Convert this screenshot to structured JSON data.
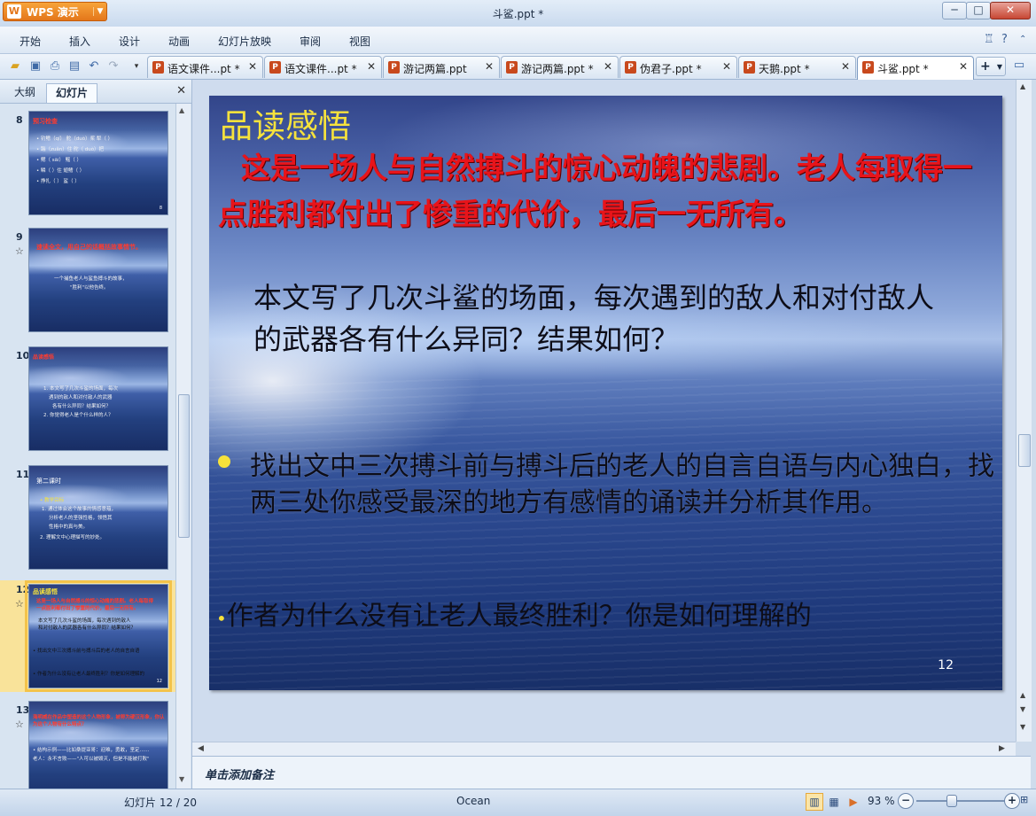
{
  "window": {
    "app_name": "WPS 演示",
    "title": "斗鲨.ppt *",
    "min": "─",
    "max": "□",
    "close": "✕"
  },
  "menu": [
    "开始",
    "插入",
    "设计",
    "动画",
    "幻灯片放映",
    "审阅",
    "视图"
  ],
  "tabs": [
    {
      "label": "语文课件...pt *"
    },
    {
      "label": "语文课件...pt *"
    },
    {
      "label": "游记两篇.ppt"
    },
    {
      "label": "游记两篇.ppt *"
    },
    {
      "label": "伪君子.ppt *"
    },
    {
      "label": "天鹅.ppt *"
    },
    {
      "label": "斗鲨.ppt *",
      "active": true
    }
  ],
  "panel": {
    "tab_outline": "大纲",
    "tab_slides": "幻灯片",
    "close": "✕"
  },
  "thumbnails": [
    {
      "num": "8",
      "star": "",
      "title": "预习检查",
      "title_color": "#ff3b2f",
      "lines": [
        "• 钓鳍（qí） 舵（duò）桨 犁（ ）",
        "• 踹（zuǎn）住 舵（ duò）把",
        "• 鳃（ sāi） 鳐（ ）",
        "• 鳞（ ）住 翅鳍（ ）",
        "• 挣扎（ ） 鲨（ ）"
      ],
      "pn": "8"
    },
    {
      "num": "9",
      "star": "☆",
      "title": "速读全文，用自己的话概括故事情节。",
      "title_color": "#ff3b2f",
      "lines": [
        "一个捕鱼老人与鲨鱼搏斗的故事，",
        "\"胜利\"以他告终。"
      ],
      "pn": ""
    },
    {
      "num": "10",
      "star": "",
      "title": "品读感悟",
      "title_color": "#ff3b2f",
      "lines": [
        "1. 本文写了几次斗鲨的场面，每次",
        "遇到的敌人和对付敌人的武器",
        "各有什么异同？结果如何？",
        "2. 你觉得老人是个什么样的人？"
      ],
      "pn": ""
    },
    {
      "num": "11",
      "star": "",
      "title": "第二课时",
      "title_color": "#ffffff",
      "lines": [
        "• 教学目标",
        "1. 通过体会这个故事的情感意蕴，",
        "分析老人的坚强性格，领悟其",
        "性格中的真与美。",
        "2. 理解文中心理描写的妙处。"
      ],
      "pn": ""
    },
    {
      "num": "12",
      "star": "☆",
      "title": "品读感悟",
      "title_color": "#f6e23c",
      "selected": true,
      "lines": [
        "这是一场人与自然搏斗的惊心动魄的悲剧。老人每取得",
        "一点胜利都付出了惨重的代价，最后一无所有。",
        "本文写了几次斗鲨的场面，每次遇到的敌人",
        "和对付敌人的武器各有什么异同？结果如何？",
        "• 找出文中三次搏斗前与搏斗后的老人的自言自语",
        "• 作者为什么没有让老人最终胜利？你是如何理解的"
      ],
      "pn": "12"
    },
    {
      "num": "13",
      "star": "☆",
      "title": "海明威在作品中塑造的这个人物形象，被称为硬汉形象，你认为这个人物有什么特点？",
      "title_color": "#ff3b2f",
      "lines": [
        "• 结构示例——比如桑提亚哥：迎难，勇敢，坚定……",
        "老人：永不言败——\"人可以被毁灭，但是不能被打败\""
      ],
      "pn": ""
    }
  ],
  "slide": {
    "heading": "品读感悟",
    "red_text": "这是一场人与自然搏斗的惊心动魄的悲剧。老人每取得一点胜利都付出了惨重的代价，最后一无所有。",
    "q1": "本文写了几次斗鲨的场面，每次遇到的敌人和对付敌人的武器各有什么异同？结果如何？",
    "bullet": "找出文中三次搏斗前与搏斗后的老人的自言自语与内心独白，找两三处你感受最深的地方有感情的诵读并分析其作用。",
    "q3_bullet": "•",
    "q3": "作者为什么没有让老人最终胜利？你是如何理解的",
    "page_number": "12"
  },
  "notes_placeholder": "单击添加备注",
  "status": {
    "slide_counter": "幻灯片 12 / 20",
    "theme": "Ocean",
    "zoom": "93 %",
    "zoom_level": 0.4
  }
}
